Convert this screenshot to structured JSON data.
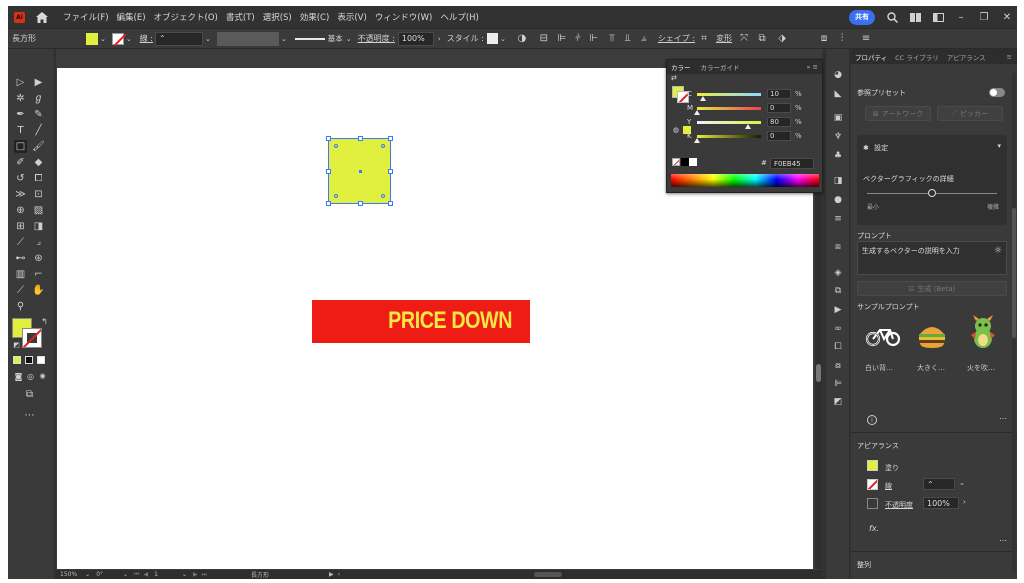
{
  "menubar": {
    "items": [
      "ファイル(F)",
      "編集(E)",
      "オブジェクト(O)",
      "書式(T)",
      "選択(S)",
      "効果(C)",
      "表示(V)",
      "ウィンドウ(W)",
      "ヘルプ(H)"
    ],
    "share_label": "共有"
  },
  "controlbar": {
    "object_type": "長方形",
    "stroke_label": "線 :",
    "stroke_style": "基本",
    "opacity_label": "不透明度 :",
    "opacity_value": "100%",
    "style_label": "スタイル :",
    "shape_label": "シェイプ :",
    "transform_label": "変形",
    "fill_color": "#e1ef3f"
  },
  "colorpanel": {
    "tabs": [
      "カラー",
      "カラーガイド"
    ],
    "rows": [
      {
        "letter": "C",
        "value": "10",
        "unit": "%",
        "level": 0.1
      },
      {
        "letter": "M",
        "value": "0",
        "unit": "%",
        "level": 0.0
      },
      {
        "letter": "Y",
        "value": "80",
        "unit": "%",
        "level": 0.8
      },
      {
        "letter": "K",
        "value": "0",
        "unit": "%",
        "level": 0.0
      }
    ],
    "hex_prefix": "#",
    "hex_value": "F0EB45"
  },
  "artboard": {
    "banner_text": "PRICE DOWN",
    "banner_color": "#ee1c14",
    "banner_text_color": "#f3e841",
    "rect_color": "#e1ef3f"
  },
  "statusbar": {
    "zoom": "150%",
    "rotation": "0°",
    "page": "1",
    "tool": "長方形"
  },
  "properties": {
    "tabs": [
      "プロパティ",
      "CC ライブラリ",
      "アピアランス"
    ],
    "reference_preset_label": "参照プリセット",
    "artwork_btn": "アートワーク",
    "picker_btn": "ピッカー",
    "settings_label": "設定",
    "vector_detail_label": "ベクターグラフィックの詳細",
    "detail_min": "最小",
    "detail_max": "複雑",
    "detail_level": 0.5,
    "prompt_heading": "プロンプト",
    "prompt_placeholder": "生成するベクターの説明を入力",
    "generate_btn": "生成 (Beta)",
    "sample_heading": "サンプルプロンプト",
    "samples": [
      "白い背…",
      "大きく…",
      "火を吹…"
    ],
    "appearance_heading": "アピアランス",
    "fill_label": "塗り",
    "stroke_label": "線",
    "opacity_label": "不透明度",
    "opacity_value": "100%",
    "fx_label": "fx.",
    "align_heading": "整列"
  }
}
